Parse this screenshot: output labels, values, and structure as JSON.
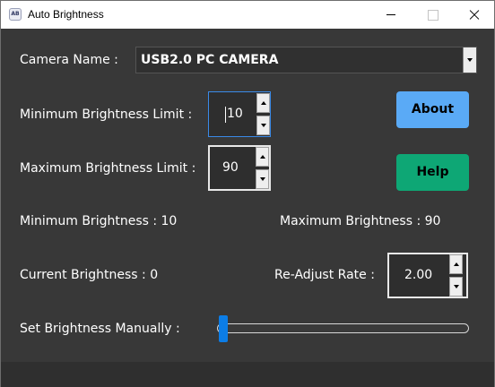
{
  "window": {
    "title": "Auto Brightness",
    "icon_text": "AB"
  },
  "camera": {
    "label": "Camera Name :",
    "selected": "USB2.0 PC CAMERA"
  },
  "min_limit": {
    "label": "Minimum Brightness Limit :",
    "value": "10"
  },
  "max_limit": {
    "label": "Maximum Brightness Limit :",
    "value": "90"
  },
  "buttons": {
    "about": "About",
    "help": "Help",
    "about_color": "#5aaaf6",
    "help_color": "#0ea775"
  },
  "stats": {
    "min_brightness": "Minimum Brightness : 10",
    "max_brightness": "Maximum Brightness : 90",
    "current_brightness": "Current Brightness : 0"
  },
  "readjust": {
    "label": "Re-Adjust Rate :",
    "value": "2.00"
  },
  "manual": {
    "label": "Set Brightness Manually :",
    "slider_value": 0,
    "slider_color": "#0c7de6"
  }
}
